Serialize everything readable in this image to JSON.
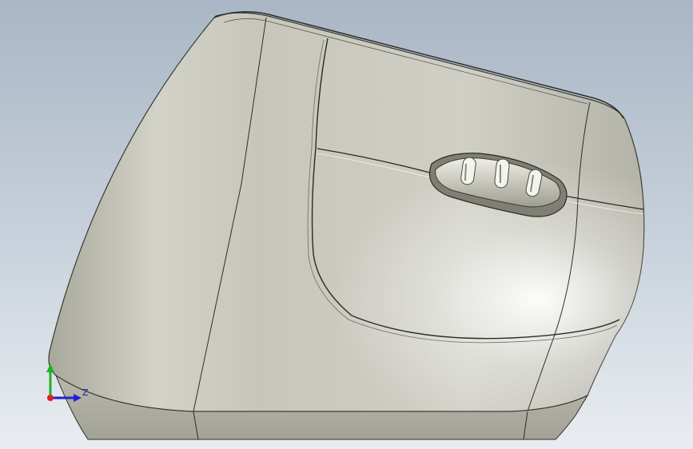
{
  "viewport": {
    "view_type": "cad-3d-model",
    "background_gradient": [
      "#a9b6c5",
      "#c9d2dc",
      "#e9edf1"
    ],
    "model_color": "#c9c9bf"
  },
  "triad": {
    "visible_axis_label": "Z",
    "colors": {
      "x": "#e02020",
      "y": "#20b020",
      "z": "#2020d8"
    }
  }
}
